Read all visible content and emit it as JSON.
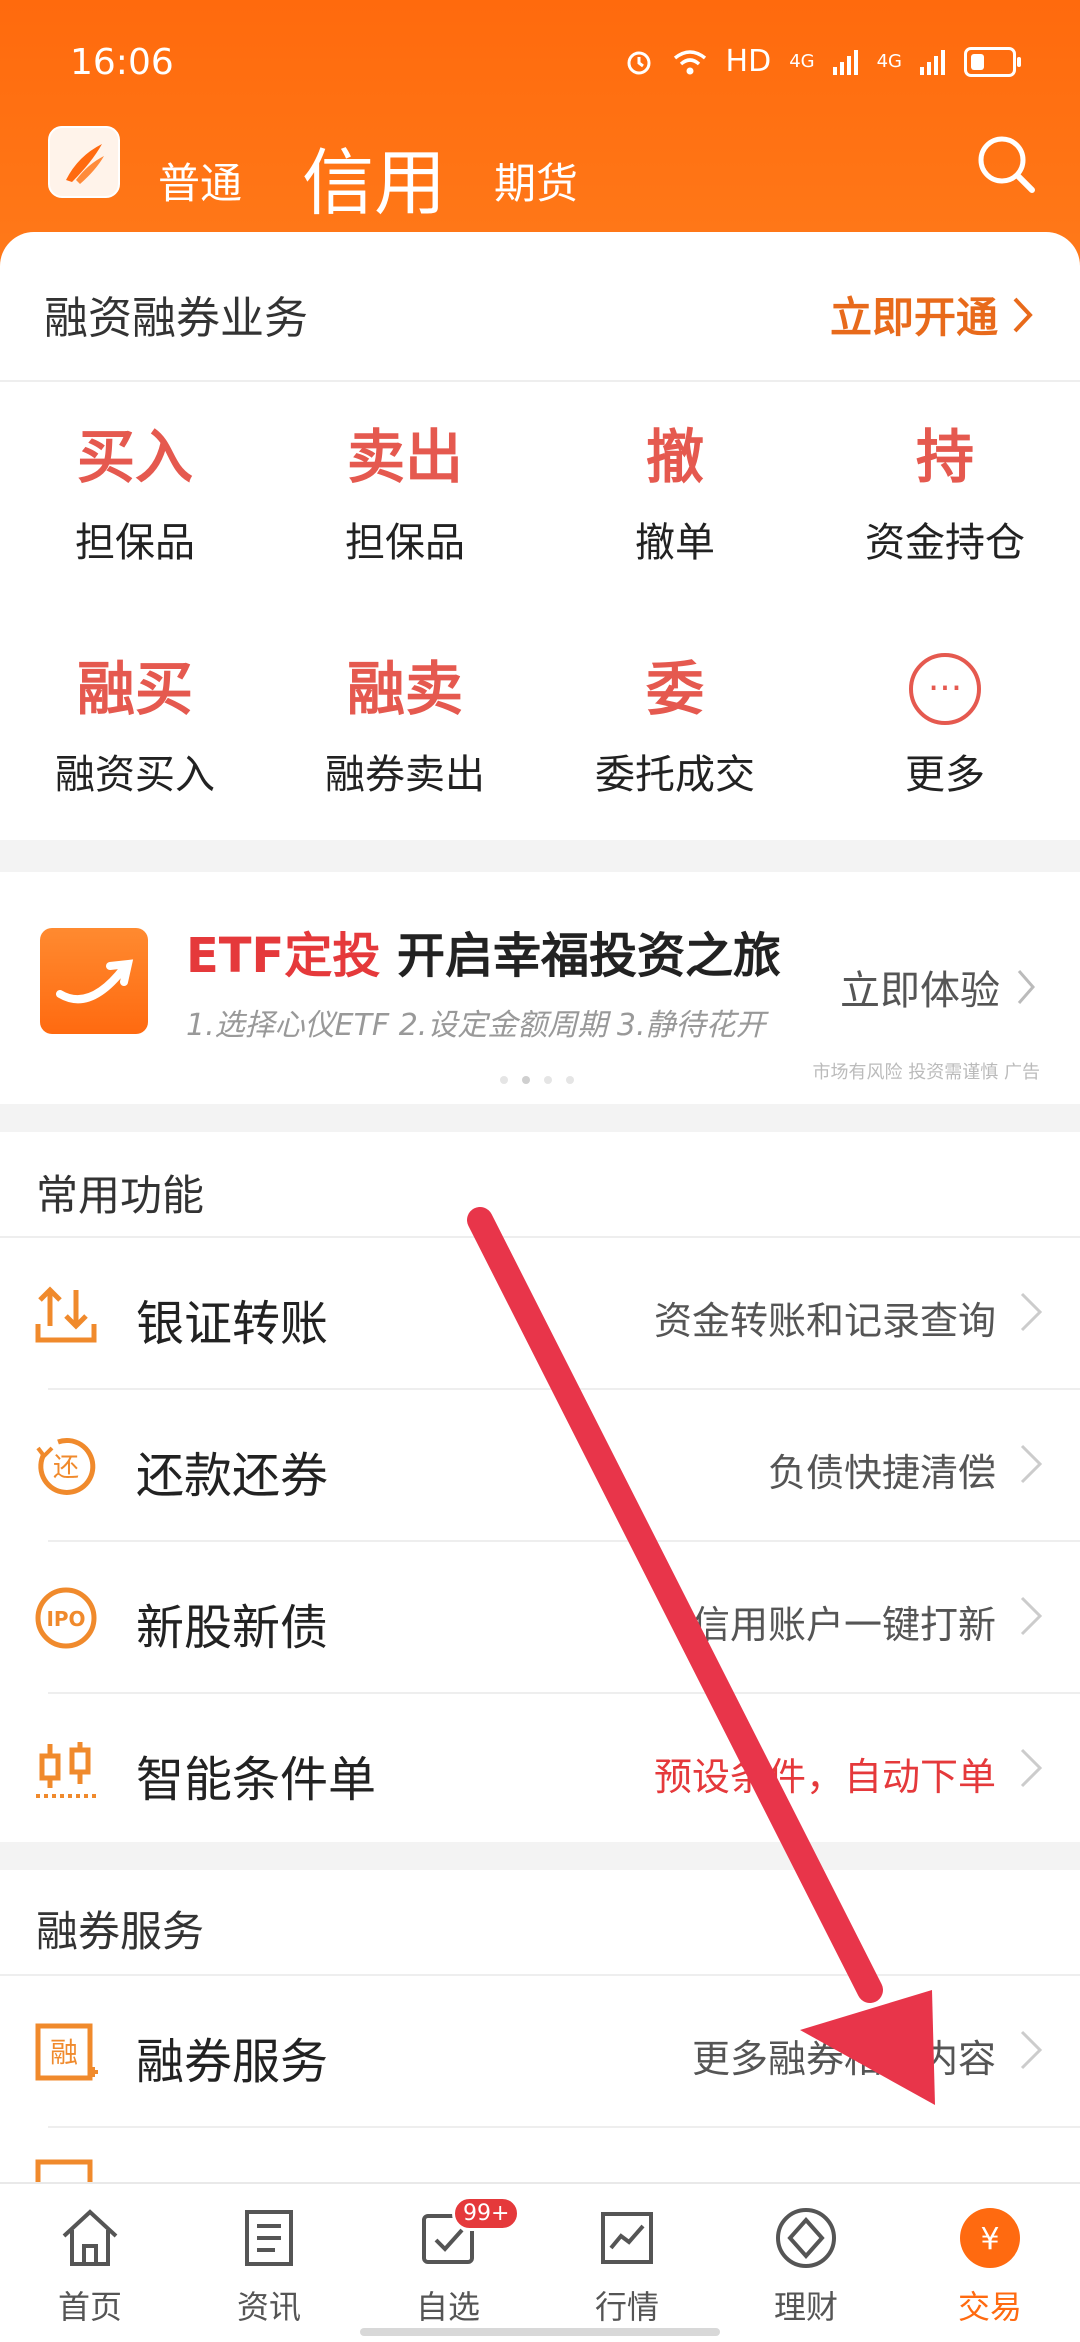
{
  "status": {
    "time": "16:06",
    "net": "HD",
    "sig1": "4G",
    "sig2": "4G"
  },
  "header": {
    "tabs": [
      "普通",
      "信用",
      "期货"
    ]
  },
  "business": {
    "title": "融资融券业务",
    "open_label": "立即开通"
  },
  "grid": [
    {
      "big": "买入",
      "small": "担保品"
    },
    {
      "big": "卖出",
      "small": "担保品"
    },
    {
      "big": "撤",
      "small": "撤单"
    },
    {
      "big": "持",
      "small": "资金持仓"
    },
    {
      "big": "融买",
      "small": "融资买入"
    },
    {
      "big": "融卖",
      "small": "融券卖出"
    },
    {
      "big": "委",
      "small": "委托成交"
    },
    {
      "big": "···",
      "small": "更多"
    }
  ],
  "banner": {
    "title_red": "ETF定投",
    "title_black": "开启幸福投资之旅",
    "steps": "1.选择心仪ETF 2.设定金额周期 3.静待花开",
    "cta": "立即体验",
    "ad_note": "市场有风险 投资需谨慎 广告"
  },
  "common": {
    "title": "常用功能",
    "rows": [
      {
        "label": "银证转账",
        "desc": "资金转账和记录查询",
        "icon": "transfer-icon"
      },
      {
        "label": "还款还券",
        "desc": "负债快捷清偿",
        "icon": "repay-icon"
      },
      {
        "label": "新股新债",
        "desc": "信用账户一键打新",
        "icon": "ipo-icon"
      },
      {
        "label": "智能条件单",
        "desc": "预设条件，自动下单",
        "icon": "condition-order-icon"
      }
    ]
  },
  "securities": {
    "title": "融券服务",
    "rows": [
      {
        "label": "融券服务",
        "desc": "更多融券相关内容",
        "icon": "securities-lending-icon"
      }
    ]
  },
  "tabbar": {
    "items": [
      "首页",
      "资讯",
      "自选",
      "行情",
      "理财",
      "交易"
    ],
    "badge": "99+"
  },
  "colors": {
    "brand": "#ff6a10",
    "accent_red": "#e5594f",
    "arrow": "#e8354a"
  }
}
